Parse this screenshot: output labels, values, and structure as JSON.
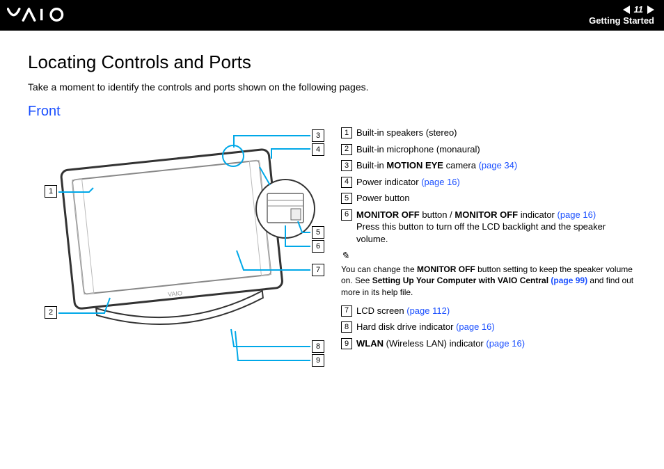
{
  "header": {
    "logo": "VAIO",
    "page_number": "11",
    "section": "Getting Started"
  },
  "title": "Locating Controls and Ports",
  "intro": "Take a moment to identify the controls and ports shown on the following pages.",
  "subtitle": "Front",
  "figure": {
    "labels": [
      "1",
      "2",
      "3",
      "4",
      "5",
      "6",
      "7",
      "8",
      "9"
    ]
  },
  "callouts": [
    {
      "n": "1",
      "text": "Built-in speakers (stereo)"
    },
    {
      "n": "2",
      "text": "Built-in microphone (monaural)"
    },
    {
      "n": "3",
      "pre": "Built-in ",
      "bold": "MOTION EYE",
      "post": " camera ",
      "link": "(page 34)"
    },
    {
      "n": "4",
      "text": "Power indicator ",
      "link": "(page 16)"
    },
    {
      "n": "5",
      "text": "Power button"
    },
    {
      "n": "6",
      "bold1": "MONITOR OFF",
      "mid": " button / ",
      "bold2": "MONITOR OFF",
      "post": " indicator ",
      "link": "(page 16)",
      "sub": "Press this button to turn off the LCD backlight and the speaker volume."
    },
    {
      "n": "7",
      "text": "LCD screen ",
      "link": "(page 112)"
    },
    {
      "n": "8",
      "text": "Hard disk drive indicator ",
      "link": "(page 16)"
    },
    {
      "n": "9",
      "bold": "WLAN",
      "post": " (Wireless LAN) indicator ",
      "link": "(page 16)"
    }
  ],
  "note": {
    "t1": "You can change the ",
    "b1": "MONITOR OFF",
    "t2": " button setting to keep the speaker volume on. See ",
    "b2": "Setting Up Your Computer with VAIO Central ",
    "link": "(page 99)",
    "t3": " and find out more in its help file."
  }
}
